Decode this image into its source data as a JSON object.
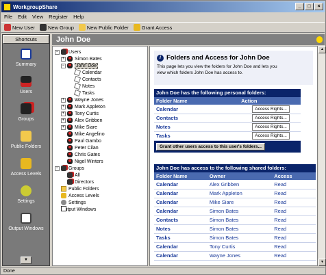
{
  "window": {
    "title": "WorkgroupShare",
    "controls": [
      "_",
      "□",
      "×"
    ]
  },
  "menu": [
    "File",
    "Edit",
    "View",
    "Register",
    "Help"
  ],
  "toolbar": {
    "new_user": "New User",
    "new_group": "New Group",
    "new_public_folder": "New Public Folder",
    "grant_access": "Grant Access"
  },
  "shortcuts": {
    "header": "Shortcuts",
    "items": [
      {
        "label": "Summary",
        "icon": "summary-icon"
      },
      {
        "label": "Users",
        "icon": "users-icon"
      },
      {
        "label": "Groups",
        "icon": "groups-icon"
      },
      {
        "label": "Public Folders",
        "icon": "folder-icon"
      },
      {
        "label": "Access Levels",
        "icon": "lock-icon"
      },
      {
        "label": "Settings",
        "icon": "gear-icon"
      },
      {
        "label": "Output Windows",
        "icon": "window-icon"
      }
    ]
  },
  "header": {
    "title": "John Doe"
  },
  "tree": {
    "users": "Users",
    "simon_bates": "Simon Bates",
    "john_doe": "John Doe",
    "calendar": "Calendar",
    "contacts": "Contacts",
    "notes": "Notes",
    "tasks": "Tasks",
    "wayne_jones": "Wayne Jones",
    "mark_appleton": "Mark Appleton",
    "tony_curtis": "Tony Curtis",
    "alex_gribben": "Alex Gribben",
    "mike_siare": "Mike Siare",
    "mike_angelino": "Mike Angelino",
    "paul_gambo": "Paul Gambo",
    "peter_cilan": "Peter Cilan",
    "chris_gates": "Chris Gates",
    "nigel_winters": "Nigel Winters",
    "groups": "Groups",
    "all": "All",
    "directors": "Directors",
    "public_folders": "Public Folders",
    "access_levels": "Access Levels",
    "settings": "Settings",
    "output_windows": "Output Windows"
  },
  "main": {
    "intro_title": "Folders and Access for John Doe",
    "intro_text_1": "This page lets you view the folders for John Doe and lets you",
    "intro_text_2": "view which folders John Doe has access to.",
    "personal": {
      "heading": "John Doe has the following personal folders:",
      "col_folder": "Folder Name",
      "col_action": "Action",
      "rows": [
        {
          "folder": "Calendar",
          "action": "Access Rights..."
        },
        {
          "folder": "Contacts",
          "action": "Access Rights..."
        },
        {
          "folder": "Notes",
          "action": "Access Rights..."
        },
        {
          "folder": "Tasks",
          "action": "Access Rights..."
        }
      ],
      "grant_button": "Grant other users access to this user's folders..."
    },
    "shared": {
      "heading": "John Doe has access to the following shared folders:",
      "col_folder": "Folder Name",
      "col_owner": "Owner",
      "col_access": "Access",
      "rows": [
        {
          "folder": "Calendar",
          "owner": "Alex Gribben",
          "access": "Read"
        },
        {
          "folder": "Calendar",
          "owner": "Mark Appleton",
          "access": "Read"
        },
        {
          "folder": "Calendar",
          "owner": "Mike Siare",
          "access": "Read"
        },
        {
          "folder": "Calendar",
          "owner": "Simon Bates",
          "access": "Read"
        },
        {
          "folder": "Contacts",
          "owner": "Simon Bates",
          "access": "Read"
        },
        {
          "folder": "Notes",
          "owner": "Simon Bates",
          "access": "Read"
        },
        {
          "folder": "Tasks",
          "owner": "Simon Bates",
          "access": "Read"
        },
        {
          "folder": "Calendar",
          "owner": "Tony Curtis",
          "access": "Read"
        },
        {
          "folder": "Calendar",
          "owner": "Wayne Jones",
          "access": "Read"
        }
      ]
    }
  },
  "status": {
    "text": "Done"
  },
  "colors": {
    "title_start": "#0a246a",
    "title_end": "#a6caf0",
    "panel_head": "#0a246a",
    "table_head": "#4a6ab0",
    "link": "#1a3a9a"
  }
}
